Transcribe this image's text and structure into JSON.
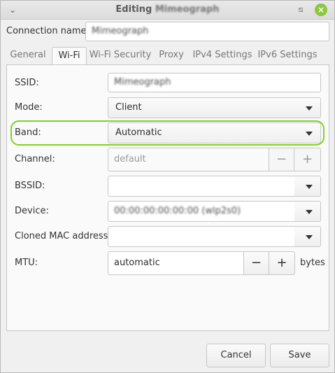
{
  "window": {
    "title_prefix": "Editing",
    "title_name": "Mimeograph",
    "icons": {
      "menu": "chevron-down-icon",
      "maximize": "restore-icon",
      "close": "close-icon"
    },
    "colors": {
      "close_button": "#8dc63f",
      "highlight": "#7ed321"
    }
  },
  "connection": {
    "label": "Connection name:",
    "value": "Mimeograph"
  },
  "tabs": [
    {
      "label": "General"
    },
    {
      "label": "Wi-Fi",
      "active": true
    },
    {
      "label": "Wi-Fi Security"
    },
    {
      "label": "Proxy"
    },
    {
      "label": "IPv4 Settings"
    },
    {
      "label": "IPv6 Settings"
    }
  ],
  "wifi": {
    "ssid": {
      "label": "SSID:",
      "value": "Mimeograph"
    },
    "mode": {
      "label": "Mode:",
      "value": "Client"
    },
    "band": {
      "label": "Band:",
      "value": "Automatic"
    },
    "channel": {
      "label": "Channel:",
      "placeholder": "default",
      "minus": "−",
      "plus": "+"
    },
    "bssid": {
      "label": "BSSID:",
      "value": ""
    },
    "device": {
      "label": "Device:",
      "value": "00:00:00:00:00:00 (wlp2s0)"
    },
    "cloned_mac": {
      "label": "Cloned MAC address:",
      "value": ""
    },
    "mtu": {
      "label": "MTU:",
      "value": "automatic",
      "minus": "−",
      "plus": "+",
      "unit": "bytes"
    }
  },
  "footer": {
    "cancel": "Cancel",
    "save": "Save"
  }
}
